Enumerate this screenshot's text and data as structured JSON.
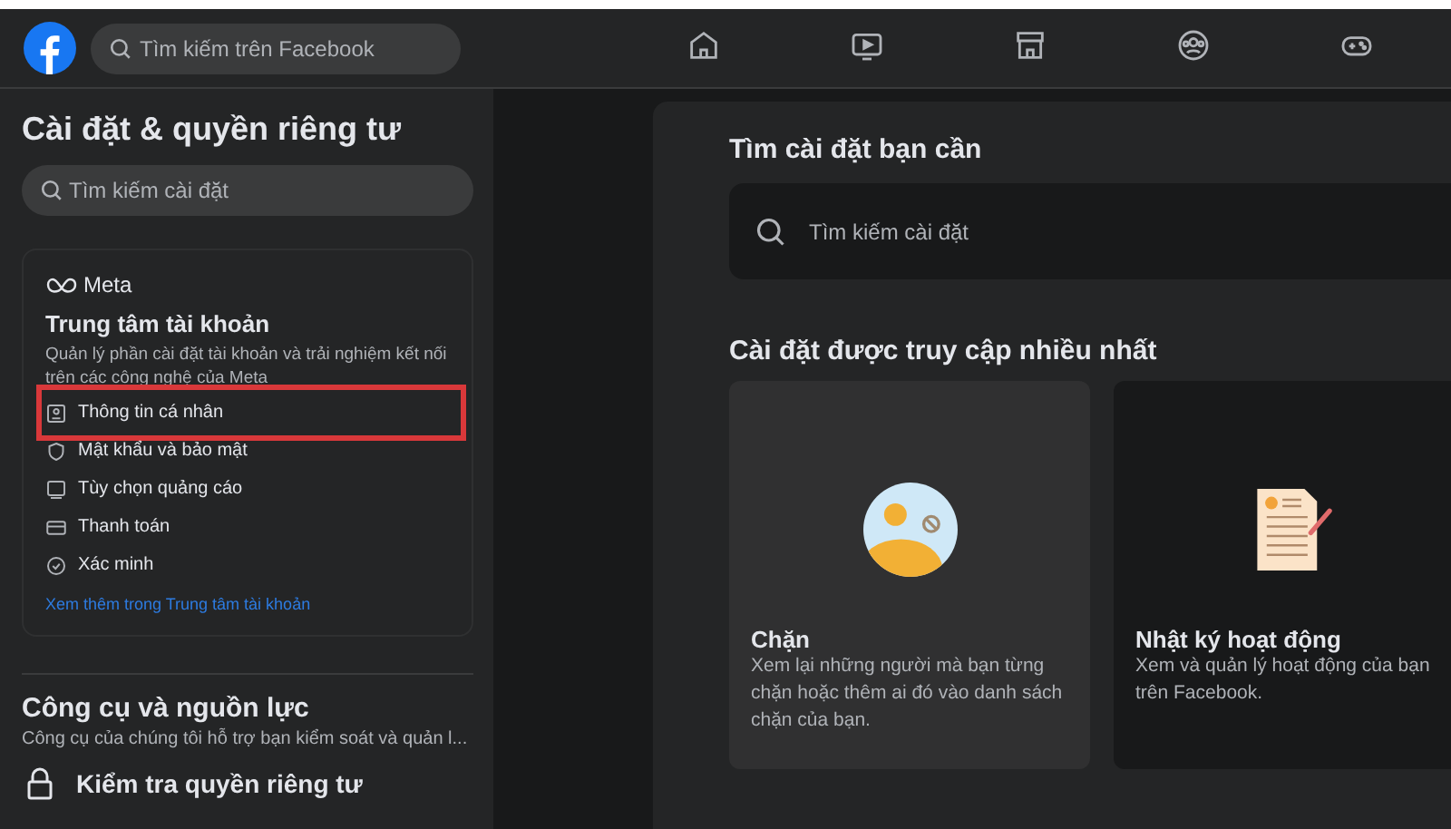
{
  "header": {
    "search": {
      "placeholder": "Tìm kiếm trên Facebook"
    },
    "nav": [
      {
        "kind": "home",
        "selected": false
      },
      {
        "kind": "video",
        "selected": false
      },
      {
        "kind": "store",
        "selected": false
      },
      {
        "kind": "groups",
        "selected": false
      },
      {
        "kind": "gaming",
        "selected": false
      }
    ]
  },
  "sidebar": {
    "title": "Cài đặt & quyền riêng tư",
    "search": {
      "placeholder": "Tìm kiếm cài đặt"
    },
    "accounts_center": {
      "brand": "Meta",
      "title": "Trung tâm tài khoản",
      "description": "Quản lý phần cài đặt tài khoản và trải nghiệm kết nối trên các công nghệ của Meta",
      "items": [
        {
          "kind": "id",
          "label": "Thông tin cá nhân",
          "highlighted": true
        },
        {
          "kind": "shield",
          "label": "Mật khẩu và bảo mật",
          "highlighted": false
        },
        {
          "kind": "ad",
          "label": "Tùy chọn quảng cáo",
          "highlighted": false
        },
        {
          "kind": "card",
          "label": "Thanh toán",
          "highlighted": false
        },
        {
          "kind": "check",
          "label": "Xác minh",
          "highlighted": false
        }
      ],
      "link": "Xem thêm trong Trung tâm tài khoản"
    },
    "tools": {
      "title": "Công cụ và nguồn lực",
      "description": "Công cụ của chúng tôi hỗ trợ bạn kiểm soát và quản l...",
      "items": [
        {
          "label": "Kiểm tra quyền riêng tư"
        }
      ]
    }
  },
  "main": {
    "search_title": "Tìm cài đặt bạn cần",
    "search": {
      "placeholder": "Tìm kiếm cài đặt"
    },
    "most_visited_title": "Cài đặt được truy cập nhiều nhất",
    "cards": [
      {
        "kind": "block",
        "title": "Chặn",
        "description": "Xem lại những người mà bạn từng chặn hoặc thêm ai đó vào danh sách chặn của bạn.",
        "selected": true
      },
      {
        "kind": "activity",
        "title": "Nhật ký hoạt động",
        "description": "Xem và quản lý hoạt động của bạn trên Facebook.",
        "selected": false
      }
    ]
  }
}
